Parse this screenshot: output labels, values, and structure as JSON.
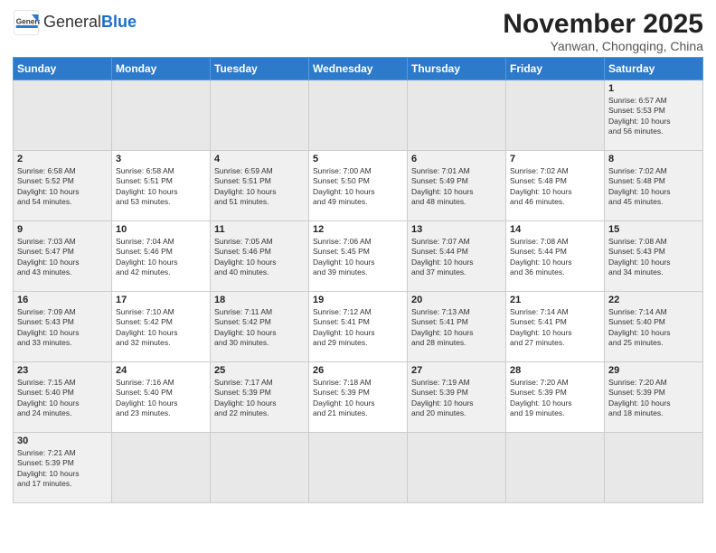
{
  "header": {
    "logo_text_general": "General",
    "logo_text_blue": "Blue",
    "month_title": "November 2025",
    "location": "Yanwan, Chongqing, China"
  },
  "weekdays": [
    "Sunday",
    "Monday",
    "Tuesday",
    "Wednesday",
    "Thursday",
    "Friday",
    "Saturday"
  ],
  "weeks": [
    [
      {
        "day": "",
        "info": ""
      },
      {
        "day": "",
        "info": ""
      },
      {
        "day": "",
        "info": ""
      },
      {
        "day": "",
        "info": ""
      },
      {
        "day": "",
        "info": ""
      },
      {
        "day": "",
        "info": ""
      },
      {
        "day": "1",
        "info": "Sunrise: 6:57 AM\nSunset: 5:53 PM\nDaylight: 10 hours\nand 56 minutes."
      }
    ],
    [
      {
        "day": "2",
        "info": "Sunrise: 6:58 AM\nSunset: 5:52 PM\nDaylight: 10 hours\nand 54 minutes."
      },
      {
        "day": "3",
        "info": "Sunrise: 6:58 AM\nSunset: 5:51 PM\nDaylight: 10 hours\nand 53 minutes."
      },
      {
        "day": "4",
        "info": "Sunrise: 6:59 AM\nSunset: 5:51 PM\nDaylight: 10 hours\nand 51 minutes."
      },
      {
        "day": "5",
        "info": "Sunrise: 7:00 AM\nSunset: 5:50 PM\nDaylight: 10 hours\nand 49 minutes."
      },
      {
        "day": "6",
        "info": "Sunrise: 7:01 AM\nSunset: 5:49 PM\nDaylight: 10 hours\nand 48 minutes."
      },
      {
        "day": "7",
        "info": "Sunrise: 7:02 AM\nSunset: 5:48 PM\nDaylight: 10 hours\nand 46 minutes."
      },
      {
        "day": "8",
        "info": "Sunrise: 7:02 AM\nSunset: 5:48 PM\nDaylight: 10 hours\nand 45 minutes."
      }
    ],
    [
      {
        "day": "9",
        "info": "Sunrise: 7:03 AM\nSunset: 5:47 PM\nDaylight: 10 hours\nand 43 minutes."
      },
      {
        "day": "10",
        "info": "Sunrise: 7:04 AM\nSunset: 5:46 PM\nDaylight: 10 hours\nand 42 minutes."
      },
      {
        "day": "11",
        "info": "Sunrise: 7:05 AM\nSunset: 5:46 PM\nDaylight: 10 hours\nand 40 minutes."
      },
      {
        "day": "12",
        "info": "Sunrise: 7:06 AM\nSunset: 5:45 PM\nDaylight: 10 hours\nand 39 minutes."
      },
      {
        "day": "13",
        "info": "Sunrise: 7:07 AM\nSunset: 5:44 PM\nDaylight: 10 hours\nand 37 minutes."
      },
      {
        "day": "14",
        "info": "Sunrise: 7:08 AM\nSunset: 5:44 PM\nDaylight: 10 hours\nand 36 minutes."
      },
      {
        "day": "15",
        "info": "Sunrise: 7:08 AM\nSunset: 5:43 PM\nDaylight: 10 hours\nand 34 minutes."
      }
    ],
    [
      {
        "day": "16",
        "info": "Sunrise: 7:09 AM\nSunset: 5:43 PM\nDaylight: 10 hours\nand 33 minutes."
      },
      {
        "day": "17",
        "info": "Sunrise: 7:10 AM\nSunset: 5:42 PM\nDaylight: 10 hours\nand 32 minutes."
      },
      {
        "day": "18",
        "info": "Sunrise: 7:11 AM\nSunset: 5:42 PM\nDaylight: 10 hours\nand 30 minutes."
      },
      {
        "day": "19",
        "info": "Sunrise: 7:12 AM\nSunset: 5:41 PM\nDaylight: 10 hours\nand 29 minutes."
      },
      {
        "day": "20",
        "info": "Sunrise: 7:13 AM\nSunset: 5:41 PM\nDaylight: 10 hours\nand 28 minutes."
      },
      {
        "day": "21",
        "info": "Sunrise: 7:14 AM\nSunset: 5:41 PM\nDaylight: 10 hours\nand 27 minutes."
      },
      {
        "day": "22",
        "info": "Sunrise: 7:14 AM\nSunset: 5:40 PM\nDaylight: 10 hours\nand 25 minutes."
      }
    ],
    [
      {
        "day": "23",
        "info": "Sunrise: 7:15 AM\nSunset: 5:40 PM\nDaylight: 10 hours\nand 24 minutes."
      },
      {
        "day": "24",
        "info": "Sunrise: 7:16 AM\nSunset: 5:40 PM\nDaylight: 10 hours\nand 23 minutes."
      },
      {
        "day": "25",
        "info": "Sunrise: 7:17 AM\nSunset: 5:39 PM\nDaylight: 10 hours\nand 22 minutes."
      },
      {
        "day": "26",
        "info": "Sunrise: 7:18 AM\nSunset: 5:39 PM\nDaylight: 10 hours\nand 21 minutes."
      },
      {
        "day": "27",
        "info": "Sunrise: 7:19 AM\nSunset: 5:39 PM\nDaylight: 10 hours\nand 20 minutes."
      },
      {
        "day": "28",
        "info": "Sunrise: 7:20 AM\nSunset: 5:39 PM\nDaylight: 10 hours\nand 19 minutes."
      },
      {
        "day": "29",
        "info": "Sunrise: 7:20 AM\nSunset: 5:39 PM\nDaylight: 10 hours\nand 18 minutes."
      }
    ],
    [
      {
        "day": "30",
        "info": "Sunrise: 7:21 AM\nSunset: 5:39 PM\nDaylight: 10 hours\nand 17 minutes."
      },
      {
        "day": "",
        "info": ""
      },
      {
        "day": "",
        "info": ""
      },
      {
        "day": "",
        "info": ""
      },
      {
        "day": "",
        "info": ""
      },
      {
        "day": "",
        "info": ""
      },
      {
        "day": "",
        "info": ""
      }
    ]
  ]
}
